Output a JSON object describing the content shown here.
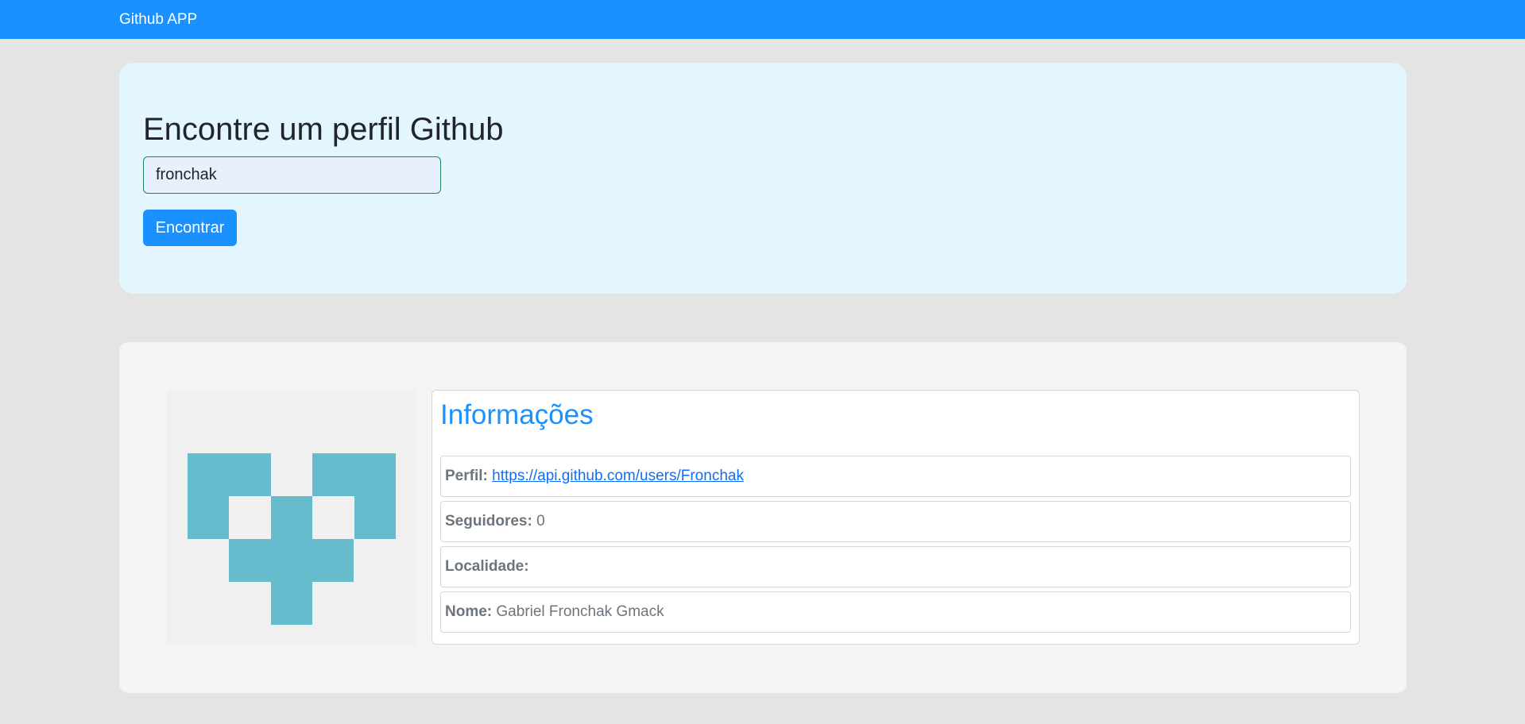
{
  "navbar": {
    "brand": "Github APP"
  },
  "search": {
    "title": "Encontre um perfil Github",
    "input_value": "fronchak",
    "button_label": "Encontrar"
  },
  "profile": {
    "avatar_color": "#66bccd",
    "info_title": "Informações",
    "rows": [
      {
        "label": "Perfil:",
        "value": "https://api.github.com/users/Fronchak"
      },
      {
        "label": "Seguidores:",
        "value": "0"
      },
      {
        "label": "Localidade:",
        "value": ""
      },
      {
        "label": "Nome:",
        "value": "Gabriel Fronchak Gmack"
      }
    ]
  },
  "colors": {
    "primary": "#1a91ff",
    "page_background": "#e4e4e4",
    "search_card_background": "#e3f6ff",
    "profile_card_background": "#f4f4f4",
    "input_border": "#198754"
  }
}
